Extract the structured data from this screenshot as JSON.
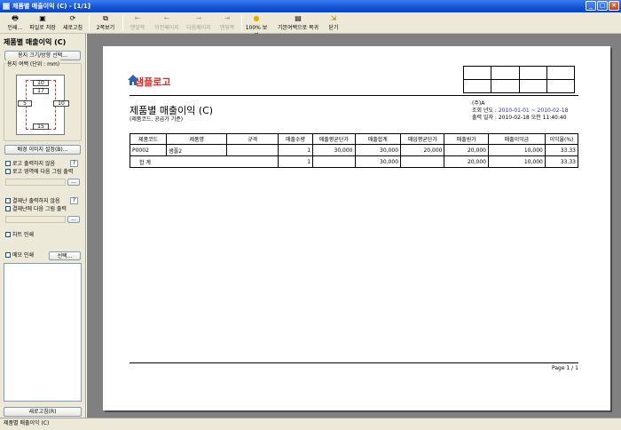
{
  "window": {
    "title": "제품별 매출이익 (C) - [1/1]"
  },
  "toolbar": {
    "print": "인쇄...",
    "save_file": "파일로 저장",
    "refresh": "새로고침",
    "two_page": "2쪽보기",
    "first": "맨앞쪽",
    "prev": "이전페이지",
    "next": "다음페이지",
    "last": "맨뒷쪽",
    "zoom100": "100% 보기",
    "restore_margin": "기본여백으로 복귀",
    "close": "닫기"
  },
  "panel": {
    "title": "제품별 매출이익 (C)",
    "paper_button": "용지 크기/방향 선택...",
    "margin_label": "용지 여백 (단위 : mm)",
    "margins": {
      "top": "10",
      "header": "17",
      "left": "5",
      "right": "10",
      "bottom": "15"
    },
    "bg_button": "배경 이미지 설정(B)...",
    "no_logo": "로고 출력하지 않음",
    "logo_image": "로고 영역에 다음 그림 출력",
    "no_approval": "결재난 출력하지 않음",
    "approval_image": "결재난에 다음 그림 출력",
    "chart_print": "차트 인쇄",
    "memo_print": "메모 인쇄",
    "select_button": "선택...",
    "refresh_button": "새로고침(R)",
    "help_mark": "?",
    "ellipsis": "..."
  },
  "report": {
    "logo_text": "샘플로고",
    "title": "제품별 매출이익 (C)",
    "subtitle": "(제품코드, 공급가 기준)",
    "company": "(주)A",
    "period_label": "조회 년도 :",
    "period_value": "2010-01-01 ~ 2010-02-18",
    "printed_label": "출력 일자 :",
    "printed_value": "2010-02-18 오전 11:40:40",
    "columns": [
      "제품코드",
      "제품명",
      "규격",
      "매출수량",
      "매출평균단가",
      "매출합계",
      "매입평균단가",
      "매출원가",
      "매출이익금",
      "이익율(%)"
    ],
    "rows": [
      [
        "P0002",
        "샘플2",
        "",
        "1",
        "30,000",
        "30,000",
        "20,000",
        "20,000",
        "10,000",
        "33.33"
      ]
    ],
    "total": {
      "label": "합 계",
      "values": [
        "1",
        "",
        "30,000",
        "",
        "20,000",
        "10,000",
        "33.33"
      ]
    },
    "page": "Page 1 / 1"
  },
  "status": {
    "text": "제품별 매출이익 (C)"
  },
  "colors": {
    "title_bar": "#1552d3",
    "logo": "#e12a25",
    "meta_blue": "#2236b4",
    "preview_bg": "#808080"
  },
  "icons": [
    "printer-icon",
    "save-icon",
    "refresh-icon",
    "two-page-icon",
    "first-page-icon",
    "prev-page-icon",
    "next-page-icon",
    "last-page-icon",
    "zoom-icon",
    "restore-icon",
    "exit-icon"
  ]
}
